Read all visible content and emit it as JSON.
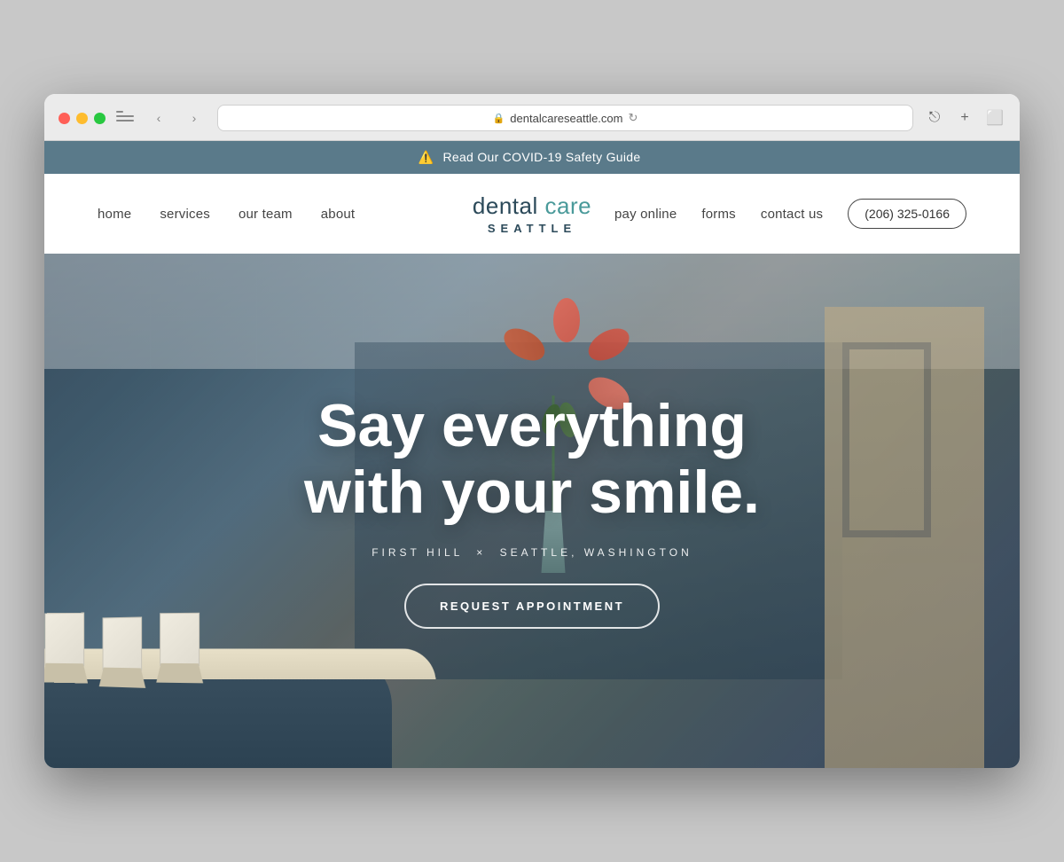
{
  "browser": {
    "url": "dentalcareseattle.com",
    "shield_icon": "🛡",
    "lock_icon": "🔒",
    "reload_icon": "↻"
  },
  "banner": {
    "icon": "⚠️",
    "text": "Read Our COVID-19 Safety Guide"
  },
  "nav": {
    "left_links": [
      {
        "label": "home",
        "id": "home"
      },
      {
        "label": "services",
        "id": "services"
      },
      {
        "label": "our team",
        "id": "our-team"
      },
      {
        "label": "about",
        "id": "about"
      }
    ],
    "logo_dental": "dental ",
    "logo_care": "care",
    "logo_city": "SEATTLE",
    "right_links": [
      {
        "label": "pay online",
        "id": "pay-online"
      },
      {
        "label": "forms",
        "id": "forms"
      },
      {
        "label": "contact us",
        "id": "contact-us"
      }
    ],
    "phone": "(206) 325-0166"
  },
  "hero": {
    "headline_line1": "Say everything",
    "headline_line2": "with your smile.",
    "location_prefix": "FIRST HILL",
    "location_sep": "×",
    "location_suffix": "SEATTLE, WASHINGTON",
    "cta_label": "REQUEST APPOINTMENT"
  }
}
